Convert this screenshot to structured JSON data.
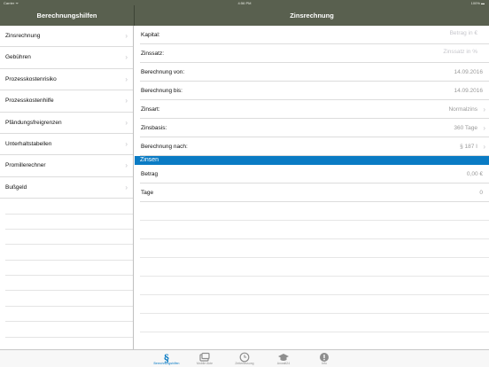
{
  "status_bar": {
    "carrier": "Carrier ᯤ",
    "time": "4:56 PM",
    "battery": "100% ▬"
  },
  "left_title": "Berechnungshilfen",
  "right_title": "Zinsrechnung",
  "sidebar": {
    "items": [
      {
        "label": "Zinsrechnung"
      },
      {
        "label": "Gebühren"
      },
      {
        "label": "Prozesskostenrisiko"
      },
      {
        "label": "Prozesskostenhilfe"
      },
      {
        "label": "Pfändungsfreigrenzen"
      },
      {
        "label": "Unterhaltstabellen"
      },
      {
        "label": "Promillerechner"
      },
      {
        "label": "Bußgeld"
      }
    ]
  },
  "form": {
    "kapital_label": "Kapital:",
    "kapital_placeholder": "Betrag in €",
    "zinssatz_label": "Zinssatz:",
    "zinssatz_placeholder": "Zinssatz in %",
    "von_label": "Berechnung von:",
    "von_value": "14.09.2016",
    "bis_label": "Berechnung bis:",
    "bis_value": "14.09.2016",
    "zinsart_label": "Zinsart:",
    "zinsart_value": "Normalzins",
    "zinsbasis_label": "Zinsbasis:",
    "zinsbasis_value": "360 Tage",
    "nach_label": "Berechnung nach:",
    "nach_value": "§ 187 I"
  },
  "result": {
    "section_title": "Zinsen",
    "betrag_label": "Betrag",
    "betrag_value": "0,00 €",
    "tage_label": "Tage",
    "tage_value": "0"
  },
  "tabbar": {
    "tabs": [
      {
        "label": "Berechnungshilfen",
        "icon": "section-sign-icon"
      },
      {
        "label": "Mobile Akte",
        "icon": "files-icon"
      },
      {
        "label": "Zeiterfassung",
        "icon": "clock-icon"
      },
      {
        "label": "Anwalt24",
        "icon": "graduation-cap-icon"
      },
      {
        "label": "Info",
        "icon": "info-icon"
      }
    ]
  },
  "colors": {
    "header": "#59604f",
    "accent": "#0a7bc4"
  }
}
